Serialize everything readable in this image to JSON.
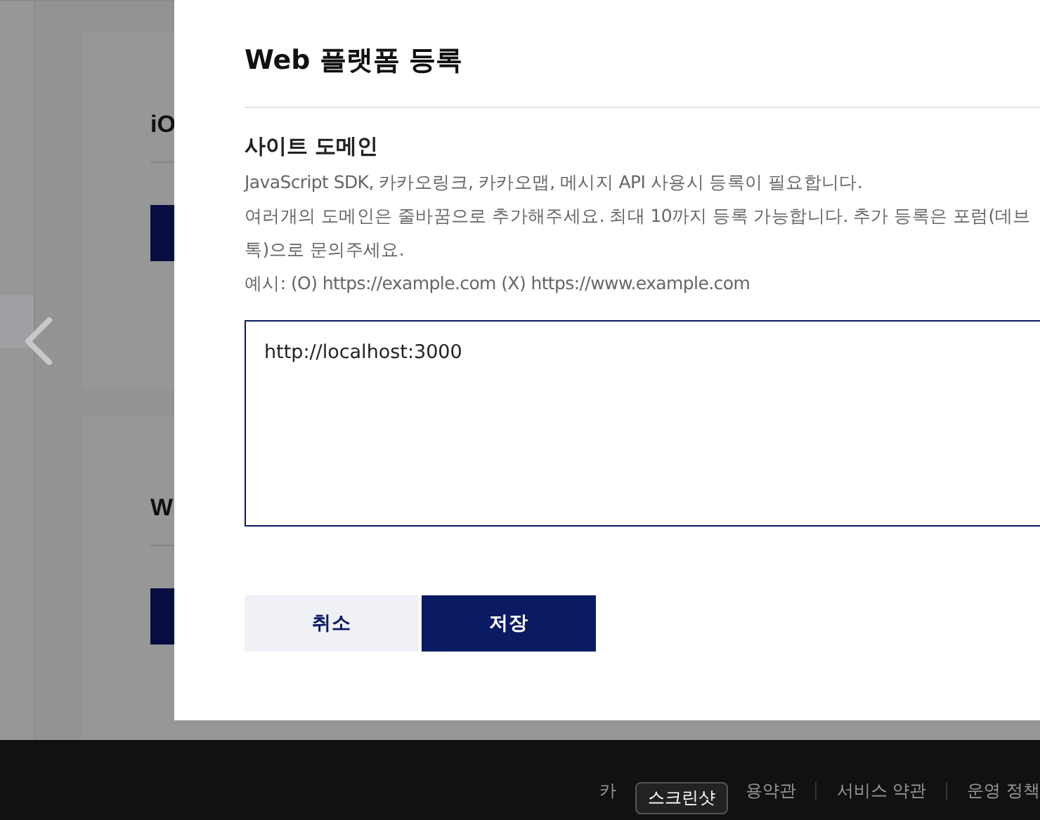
{
  "background": {
    "cards": [
      {
        "title": "iO"
      },
      {
        "title": "W"
      }
    ]
  },
  "modal": {
    "title": "Web 플랫폼 등록",
    "section": {
      "heading": "사이트 도메인",
      "lines": [
        "JavaScript SDK, 카카오링크, 카카오맵, 메시지 API 사용시 등록이 필요합니다.",
        "여러개의 도메인은 줄바꿈으로 추가해주세요. 최대 10까지 등록 가능합니다. 추가 등록은 포럼(데브톡)으로 문의주세요.",
        "예시: (O) https://example.com (X) https://www.example.com"
      ]
    },
    "domains": {
      "value": "http://localhost:3000"
    },
    "buttons": [
      {
        "label": "취소",
        "kind": "secondary"
      },
      {
        "label": "저장",
        "kind": "primary"
      }
    ]
  },
  "footer": {
    "links": [
      "카",
      "용약관",
      "서비스 약관",
      "운영 정책"
    ]
  },
  "tooltip": {
    "text": "스크린샷"
  }
}
